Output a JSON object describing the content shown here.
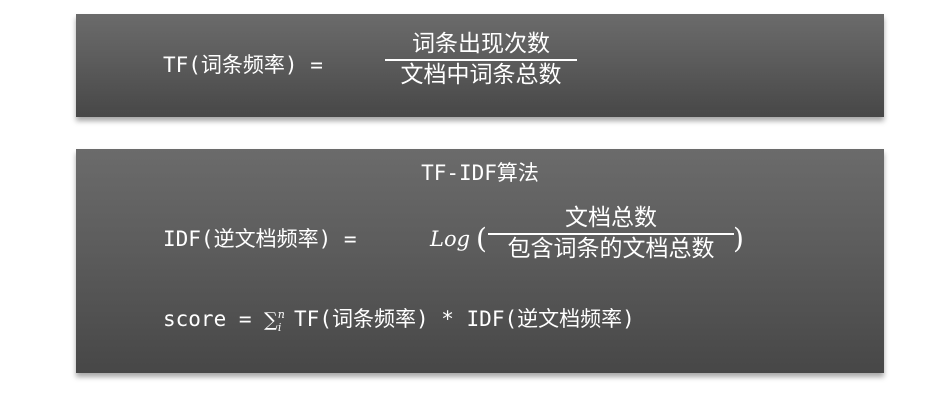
{
  "tf_panel": {
    "lhs": "TF(词条频率) =",
    "numerator": "词条出现次数",
    "denominator": "文档中词条总数"
  },
  "tfidf_panel": {
    "title": "TF-IDF算法",
    "idf": {
      "lhs": "IDF(逆文档频率) =",
      "log": "Log",
      "open_paren": "(",
      "close_paren": ")",
      "numerator": "文档总数",
      "denominator": "包含词条的文档总数"
    },
    "score": {
      "lhs": "score =",
      "sum_symbol": "∑",
      "sum_upper": "n",
      "sum_lower": "i",
      "rhs": "TF(词条频率) * IDF(逆文档频率)"
    }
  }
}
